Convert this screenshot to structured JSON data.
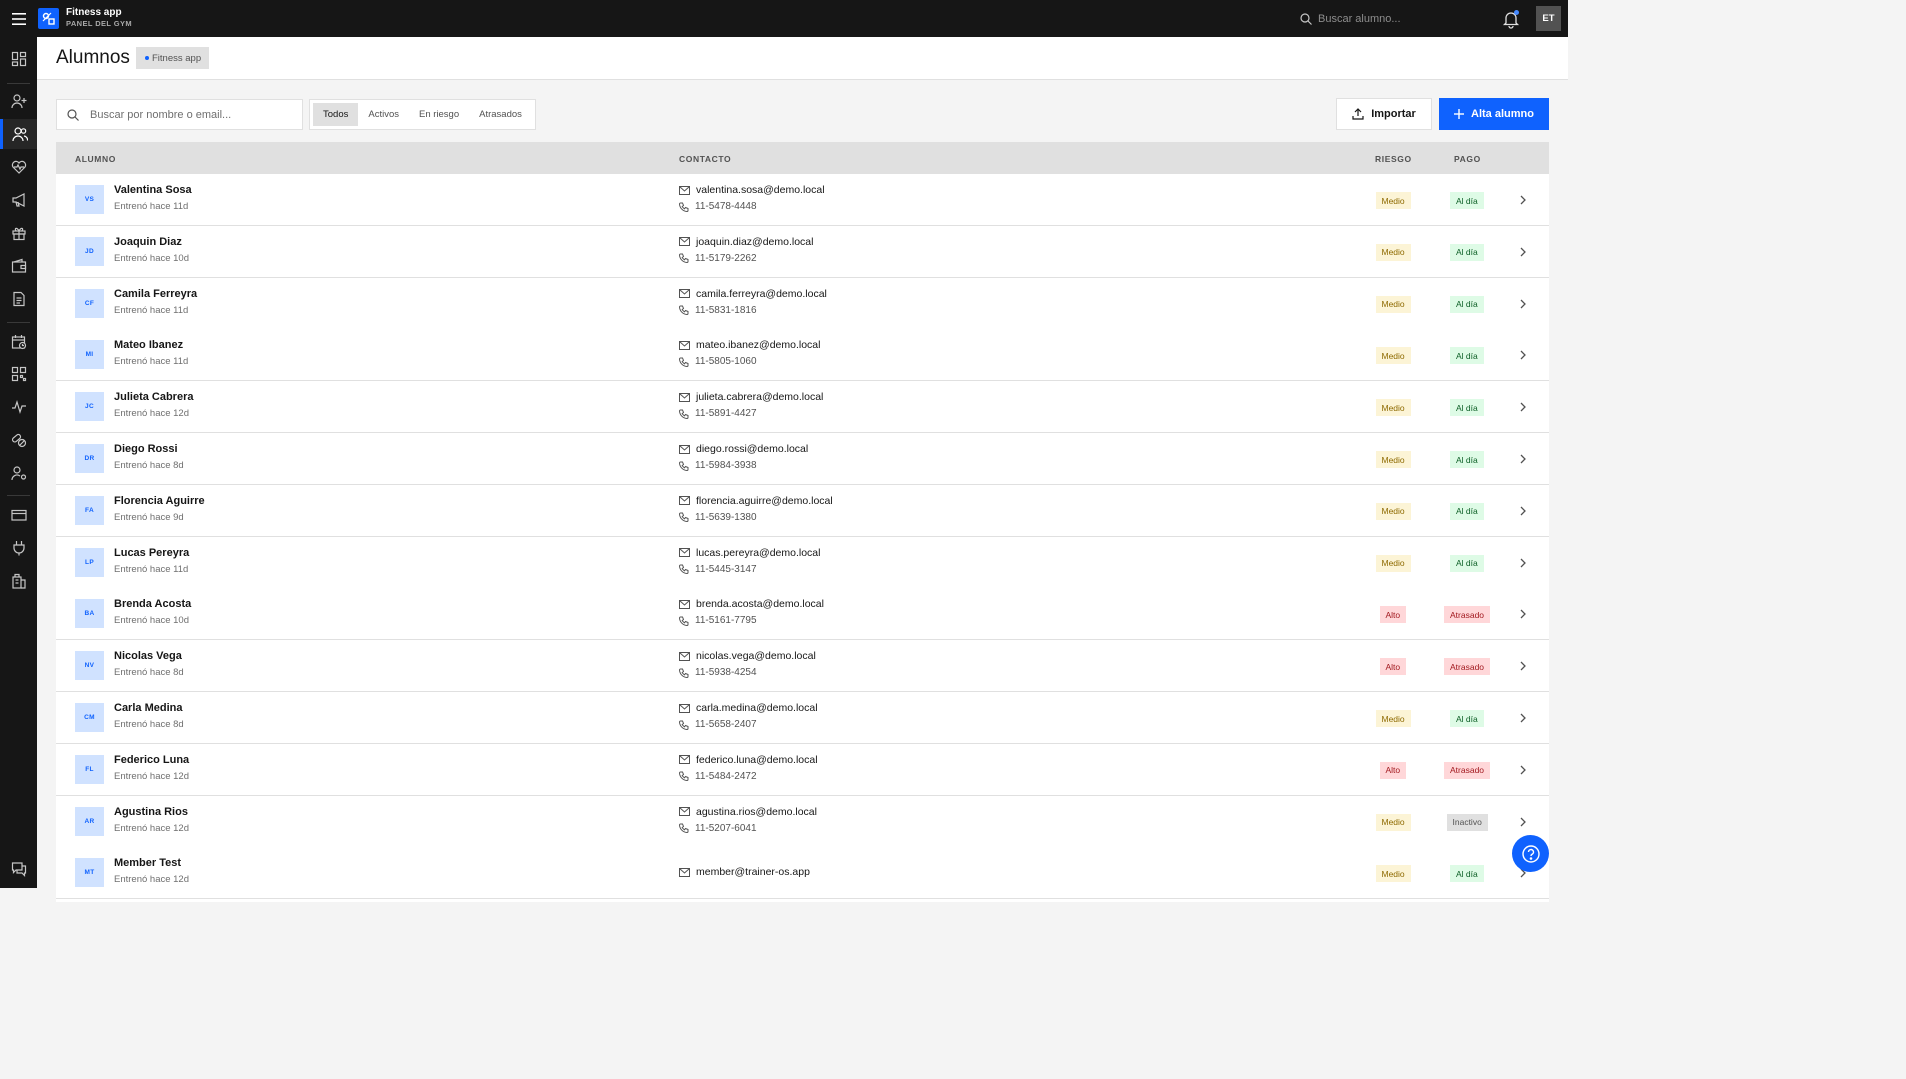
{
  "app": {
    "name": "Fitness app",
    "subtitle": "PANEL DEL GYM",
    "user_initials": "ET"
  },
  "topbar": {
    "search_placeholder": "Buscar alumno..."
  },
  "header": {
    "title": "Alumnos",
    "tag": "Fitness app"
  },
  "toolbar": {
    "search_placeholder": "Buscar por nombre o email...",
    "filters": [
      "Todos",
      "Activos",
      "En riesgo",
      "Atrasados"
    ],
    "active_filter": "Todos",
    "import_label": "Importar",
    "add_label": "Alta alumno"
  },
  "table": {
    "columns": {
      "alumno": "ALUMNO",
      "contacto": "CONTACTO",
      "riesgo": "RIESGO",
      "pago": "PAGO"
    },
    "rows": [
      {
        "initials": "VS",
        "name": "Valentina Sosa",
        "last": "Entrenó hace 11d",
        "email": "valentina.sosa@demo.local",
        "phone": "11-5478-4448",
        "risk": "Medio",
        "pay": "Al día"
      },
      {
        "initials": "JD",
        "name": "Joaquin Diaz",
        "last": "Entrenó hace 10d",
        "email": "joaquin.diaz@demo.local",
        "phone": "11-5179-2262",
        "risk": "Medio",
        "pay": "Al día"
      },
      {
        "initials": "CF",
        "name": "Camila Ferreyra",
        "last": "Entrenó hace 11d",
        "email": "camila.ferreyra@demo.local",
        "phone": "11-5831-1816",
        "risk": "Medio",
        "pay": "Al día"
      },
      {
        "initials": "MI",
        "name": "Mateo Ibanez",
        "last": "Entrenó hace 11d",
        "email": "mateo.ibanez@demo.local",
        "phone": "11-5805-1060",
        "risk": "Medio",
        "pay": "Al día"
      },
      {
        "initials": "JC",
        "name": "Julieta Cabrera",
        "last": "Entrenó hace 12d",
        "email": "julieta.cabrera@demo.local",
        "phone": "11-5891-4427",
        "risk": "Medio",
        "pay": "Al día"
      },
      {
        "initials": "DR",
        "name": "Diego Rossi",
        "last": "Entrenó hace 8d",
        "email": "diego.rossi@demo.local",
        "phone": "11-5984-3938",
        "risk": "Medio",
        "pay": "Al día"
      },
      {
        "initials": "FA",
        "name": "Florencia Aguirre",
        "last": "Entrenó hace 9d",
        "email": "florencia.aguirre@demo.local",
        "phone": "11-5639-1380",
        "risk": "Medio",
        "pay": "Al día"
      },
      {
        "initials": "LP",
        "name": "Lucas Pereyra",
        "last": "Entrenó hace 11d",
        "email": "lucas.pereyra@demo.local",
        "phone": "11-5445-3147",
        "risk": "Medio",
        "pay": "Al día"
      },
      {
        "initials": "BA",
        "name": "Brenda Acosta",
        "last": "Entrenó hace 10d",
        "email": "brenda.acosta@demo.local",
        "phone": "11-5161-7795",
        "risk": "Alto",
        "pay": "Atrasado"
      },
      {
        "initials": "NV",
        "name": "Nicolas Vega",
        "last": "Entrenó hace 8d",
        "email": "nicolas.vega@demo.local",
        "phone": "11-5938-4254",
        "risk": "Alto",
        "pay": "Atrasado"
      },
      {
        "initials": "CM",
        "name": "Carla Medina",
        "last": "Entrenó hace 8d",
        "email": "carla.medina@demo.local",
        "phone": "11-5658-2407",
        "risk": "Medio",
        "pay": "Al día"
      },
      {
        "initials": "FL",
        "name": "Federico Luna",
        "last": "Entrenó hace 12d",
        "email": "federico.luna@demo.local",
        "phone": "11-5484-2472",
        "risk": "Alto",
        "pay": "Atrasado"
      },
      {
        "initials": "AR",
        "name": "Agustina Rios",
        "last": "Entrenó hace 12d",
        "email": "agustina.rios@demo.local",
        "phone": "11-5207-6041",
        "risk": "Medio",
        "pay": "Inactivo"
      },
      {
        "initials": "MT",
        "name": "Member Test",
        "last": "Entrenó hace 12d",
        "email": "member@trainer-os.app",
        "phone": "",
        "risk": "Medio",
        "pay": "Al día"
      }
    ]
  },
  "sidebar": {
    "items": [
      {
        "icon": "dashboard-icon"
      },
      {
        "icon": "add-user-icon"
      },
      {
        "icon": "users-icon",
        "active": true
      },
      {
        "icon": "health-icon"
      },
      {
        "icon": "megaphone-icon"
      },
      {
        "icon": "gift-icon"
      },
      {
        "icon": "wallet-icon"
      },
      {
        "icon": "document-icon"
      },
      {
        "icon": "calendar-icon"
      },
      {
        "icon": "qr-code-icon"
      },
      {
        "icon": "activity-icon"
      },
      {
        "icon": "pills-icon"
      },
      {
        "icon": "user-settings-icon"
      },
      {
        "icon": "credit-card-icon"
      },
      {
        "icon": "plug-icon"
      },
      {
        "icon": "building-icon"
      },
      {
        "icon": "chat-icon"
      }
    ]
  },
  "colors": {
    "accent": "#0f62fe",
    "topbar": "#161616",
    "background": "#f4f4f4"
  }
}
